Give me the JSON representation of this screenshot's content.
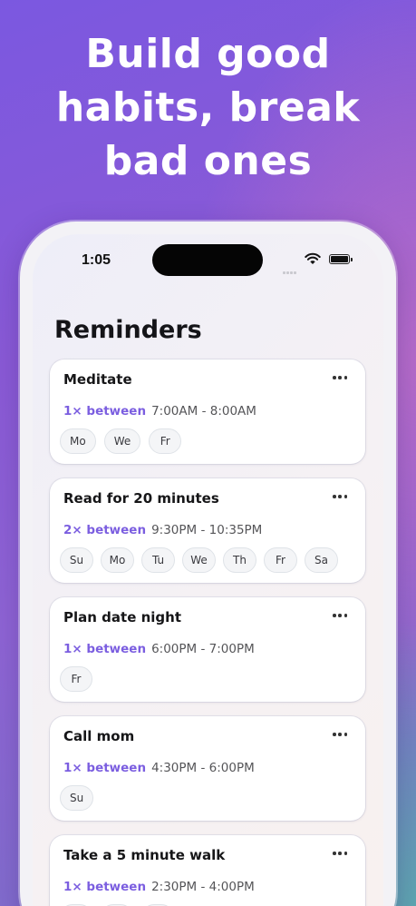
{
  "headline": {
    "line1": "Build good",
    "line2": "habits, break",
    "line3": "bad ones"
  },
  "status_bar": {
    "time": "1:05"
  },
  "page": {
    "title": "Reminders"
  },
  "reminders": [
    {
      "title": "Meditate",
      "frequency": "1× between",
      "time_range": "7:00AM - 8:00AM",
      "days": [
        "Mo",
        "We",
        "Fr"
      ]
    },
    {
      "title": "Read for 20 minutes",
      "frequency": "2× between",
      "time_range": "9:30PM - 10:35PM",
      "days": [
        "Su",
        "Mo",
        "Tu",
        "We",
        "Th",
        "Fr",
        "Sa"
      ]
    },
    {
      "title": "Plan date night",
      "frequency": "1× between",
      "time_range": "6:00PM - 7:00PM",
      "days": [
        "Fr"
      ]
    },
    {
      "title": "Call mom",
      "frequency": "1× between",
      "time_range": "4:30PM - 6:00PM",
      "days": [
        "Su"
      ]
    },
    {
      "title": "Take a 5 minute walk",
      "frequency": "1× between",
      "time_range": "2:30PM - 4:00PM",
      "days": [
        "",
        "",
        ""
      ]
    }
  ],
  "colors": {
    "accent": "#7b5ee0",
    "background_top": "#7b58e0",
    "background_right": "#b56bc9",
    "background_bottom_right": "#5ea6b0"
  }
}
